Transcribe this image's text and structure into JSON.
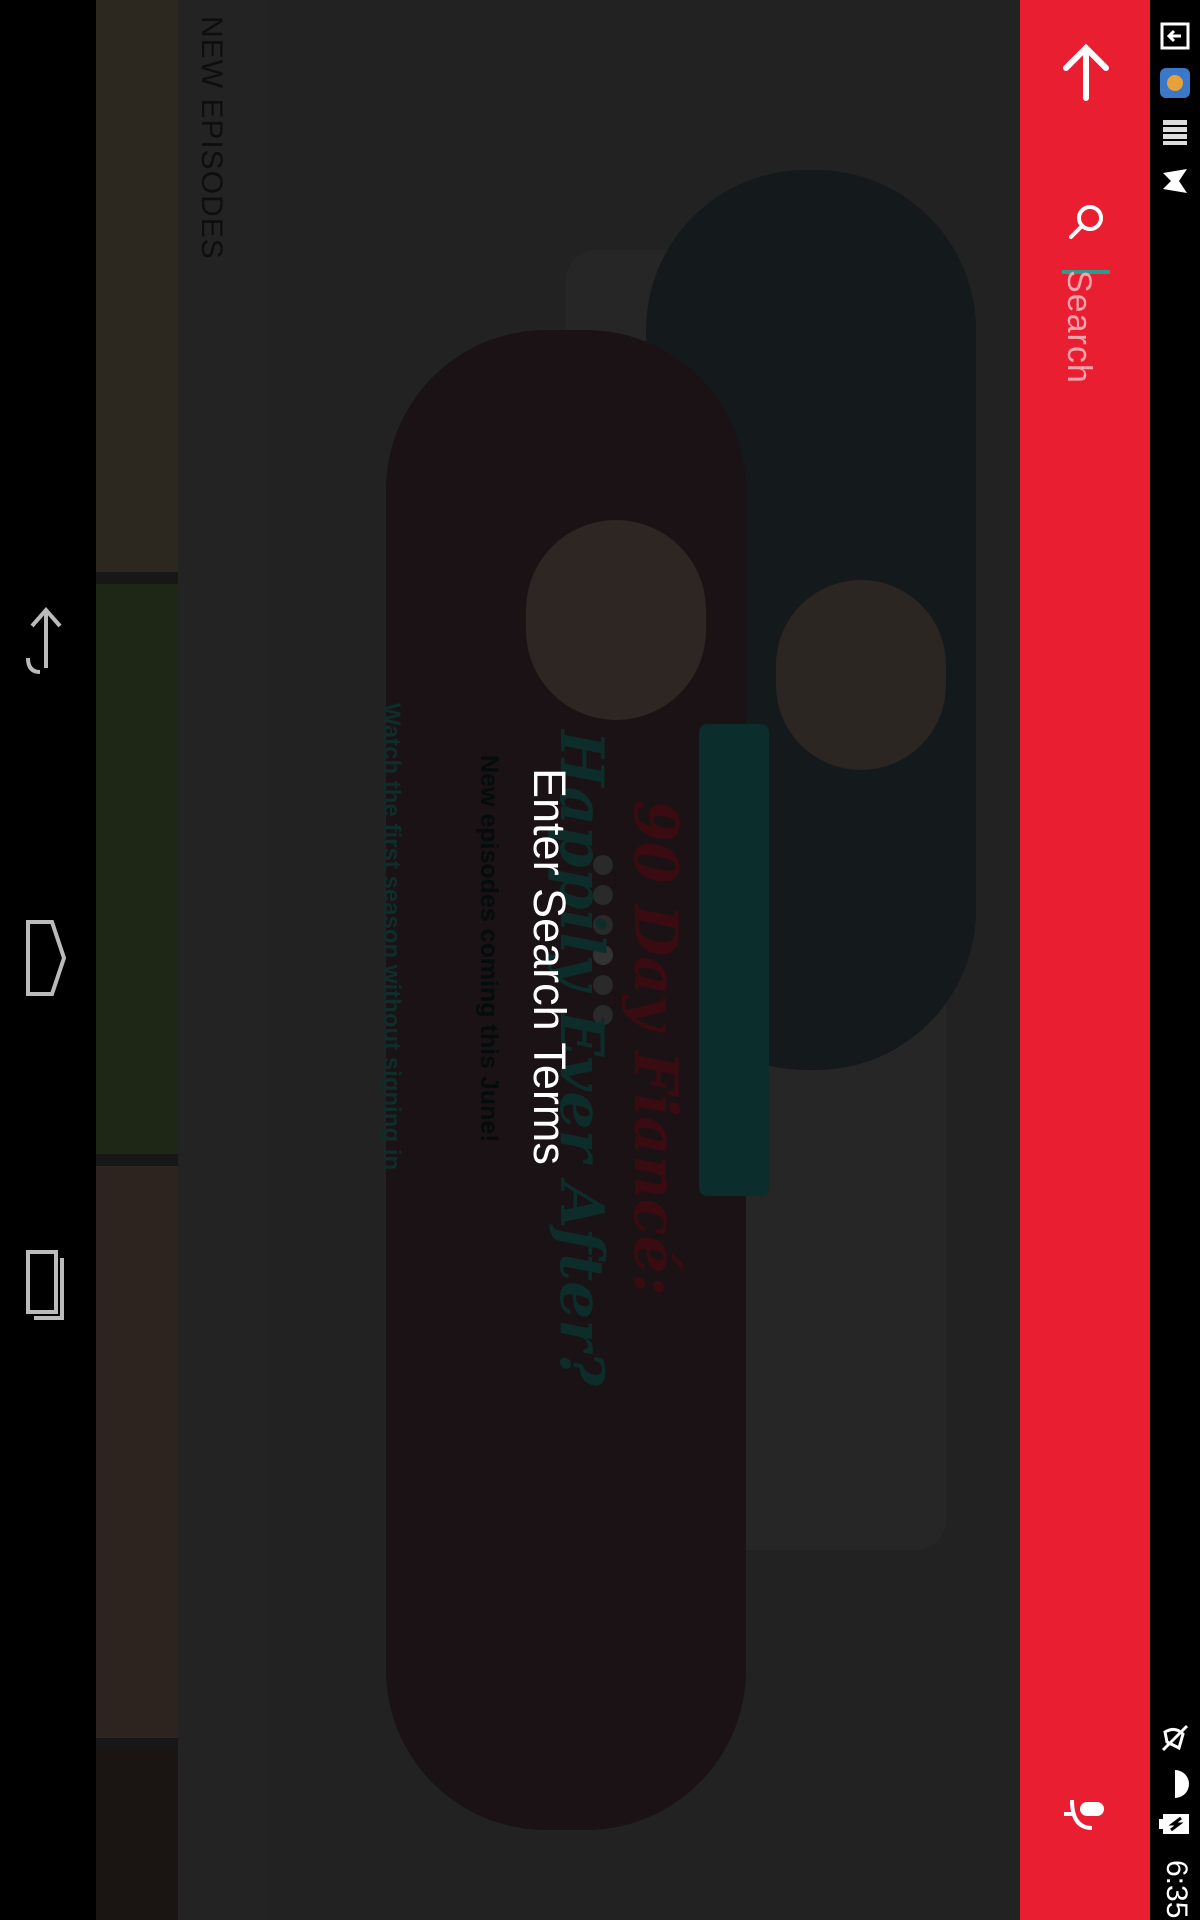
{
  "search": {
    "placeholder": "Search",
    "empty_hint": "Enter Search Terms"
  },
  "section": {
    "title": "NEW EPISODES"
  },
  "hero": {
    "show_title": "90 Day Fiancé:",
    "show_subtitle": "Happily Ever After?",
    "cta_label": "New episodes coming this June!",
    "watch_text": "Watch the first season without signing in",
    "carousel_dots": 6,
    "active_dot": 5
  },
  "status_bar": {
    "time": "6:35",
    "icons": [
      "screen-cast-icon",
      "app-notification-icon",
      "storage-icon",
      "play-store-icon",
      "mute-icon",
      "wifi-icon",
      "battery-charging-icon"
    ]
  },
  "nav_bar": {
    "icons": [
      "back-icon",
      "home-icon",
      "recents-icon"
    ]
  },
  "colors": {
    "accent": "#e91e30",
    "cursor": "#2e9c8c",
    "overlay_bg": "#1b1b1b"
  }
}
